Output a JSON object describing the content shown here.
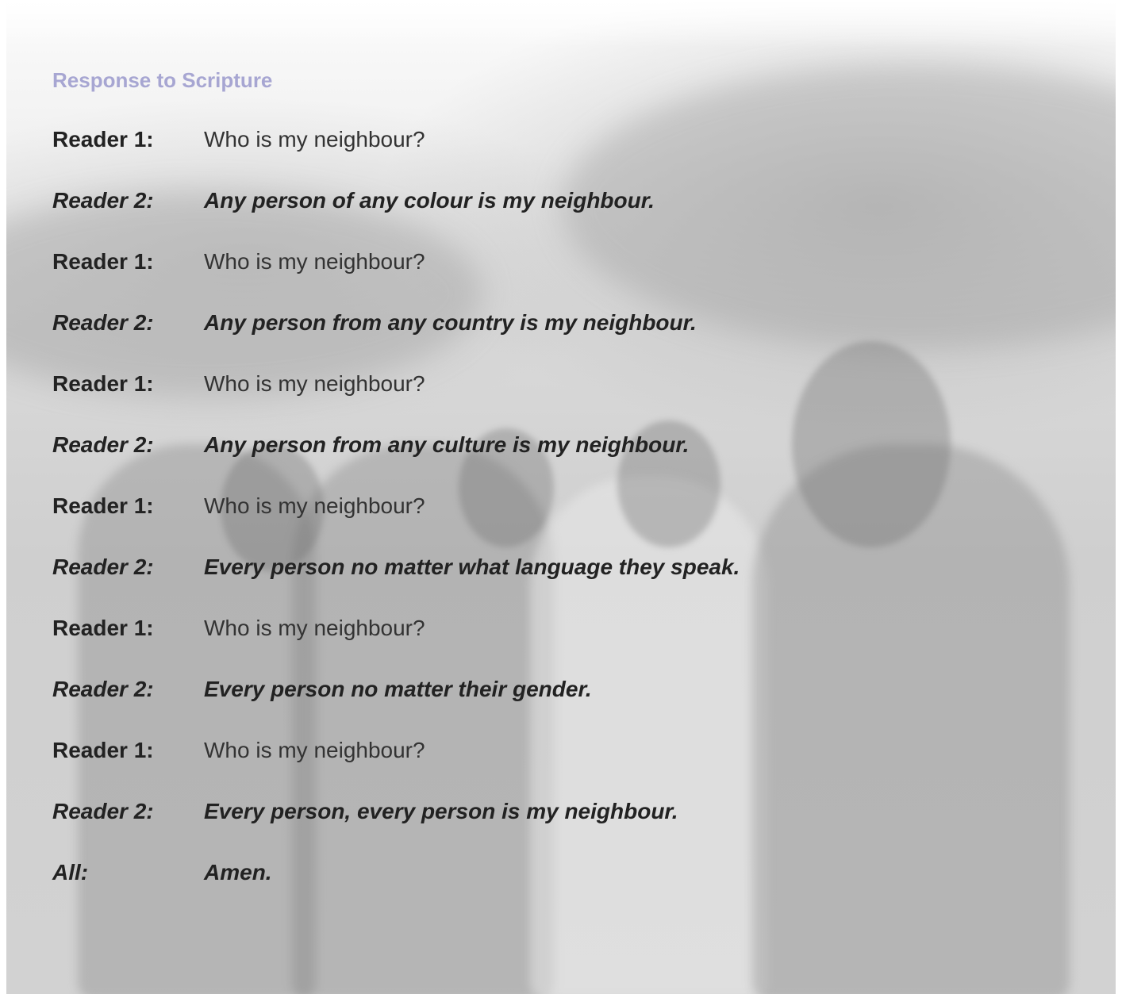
{
  "heading": "Response to Scripture",
  "lines": [
    {
      "speaker": "Reader 1:",
      "text": "Who is my neighbour?"
    },
    {
      "speaker": "Reader 2:",
      "text": "Any person of any colour is my neighbour."
    },
    {
      "speaker": "Reader 1:",
      "text": "Who is my neighbour?"
    },
    {
      "speaker": "Reader 2:",
      "text": "Any person from any country is my neighbour."
    },
    {
      "speaker": "Reader 1:",
      "text": "Who is my neighbour?"
    },
    {
      "speaker": "Reader 2:",
      "text": "Any person from any culture is my neighbour."
    },
    {
      "speaker": "Reader 1:",
      "text": "Who is my neighbour?"
    },
    {
      "speaker": "Reader 2:",
      "text": "Every person no matter what language they speak."
    },
    {
      "speaker": "Reader 1:",
      "text": "Who is my neighbour?"
    },
    {
      "speaker": "Reader 2:",
      "text": "Every person no matter their gender."
    },
    {
      "speaker": "Reader 1:",
      "text": "Who is my neighbour?"
    },
    {
      "speaker": "Reader 2:",
      "text": "Every person, every person is my neighbour."
    },
    {
      "speaker": "All:",
      "text": "Amen."
    }
  ],
  "background_image": "four-women-laughing-arm-in-arm-photo"
}
